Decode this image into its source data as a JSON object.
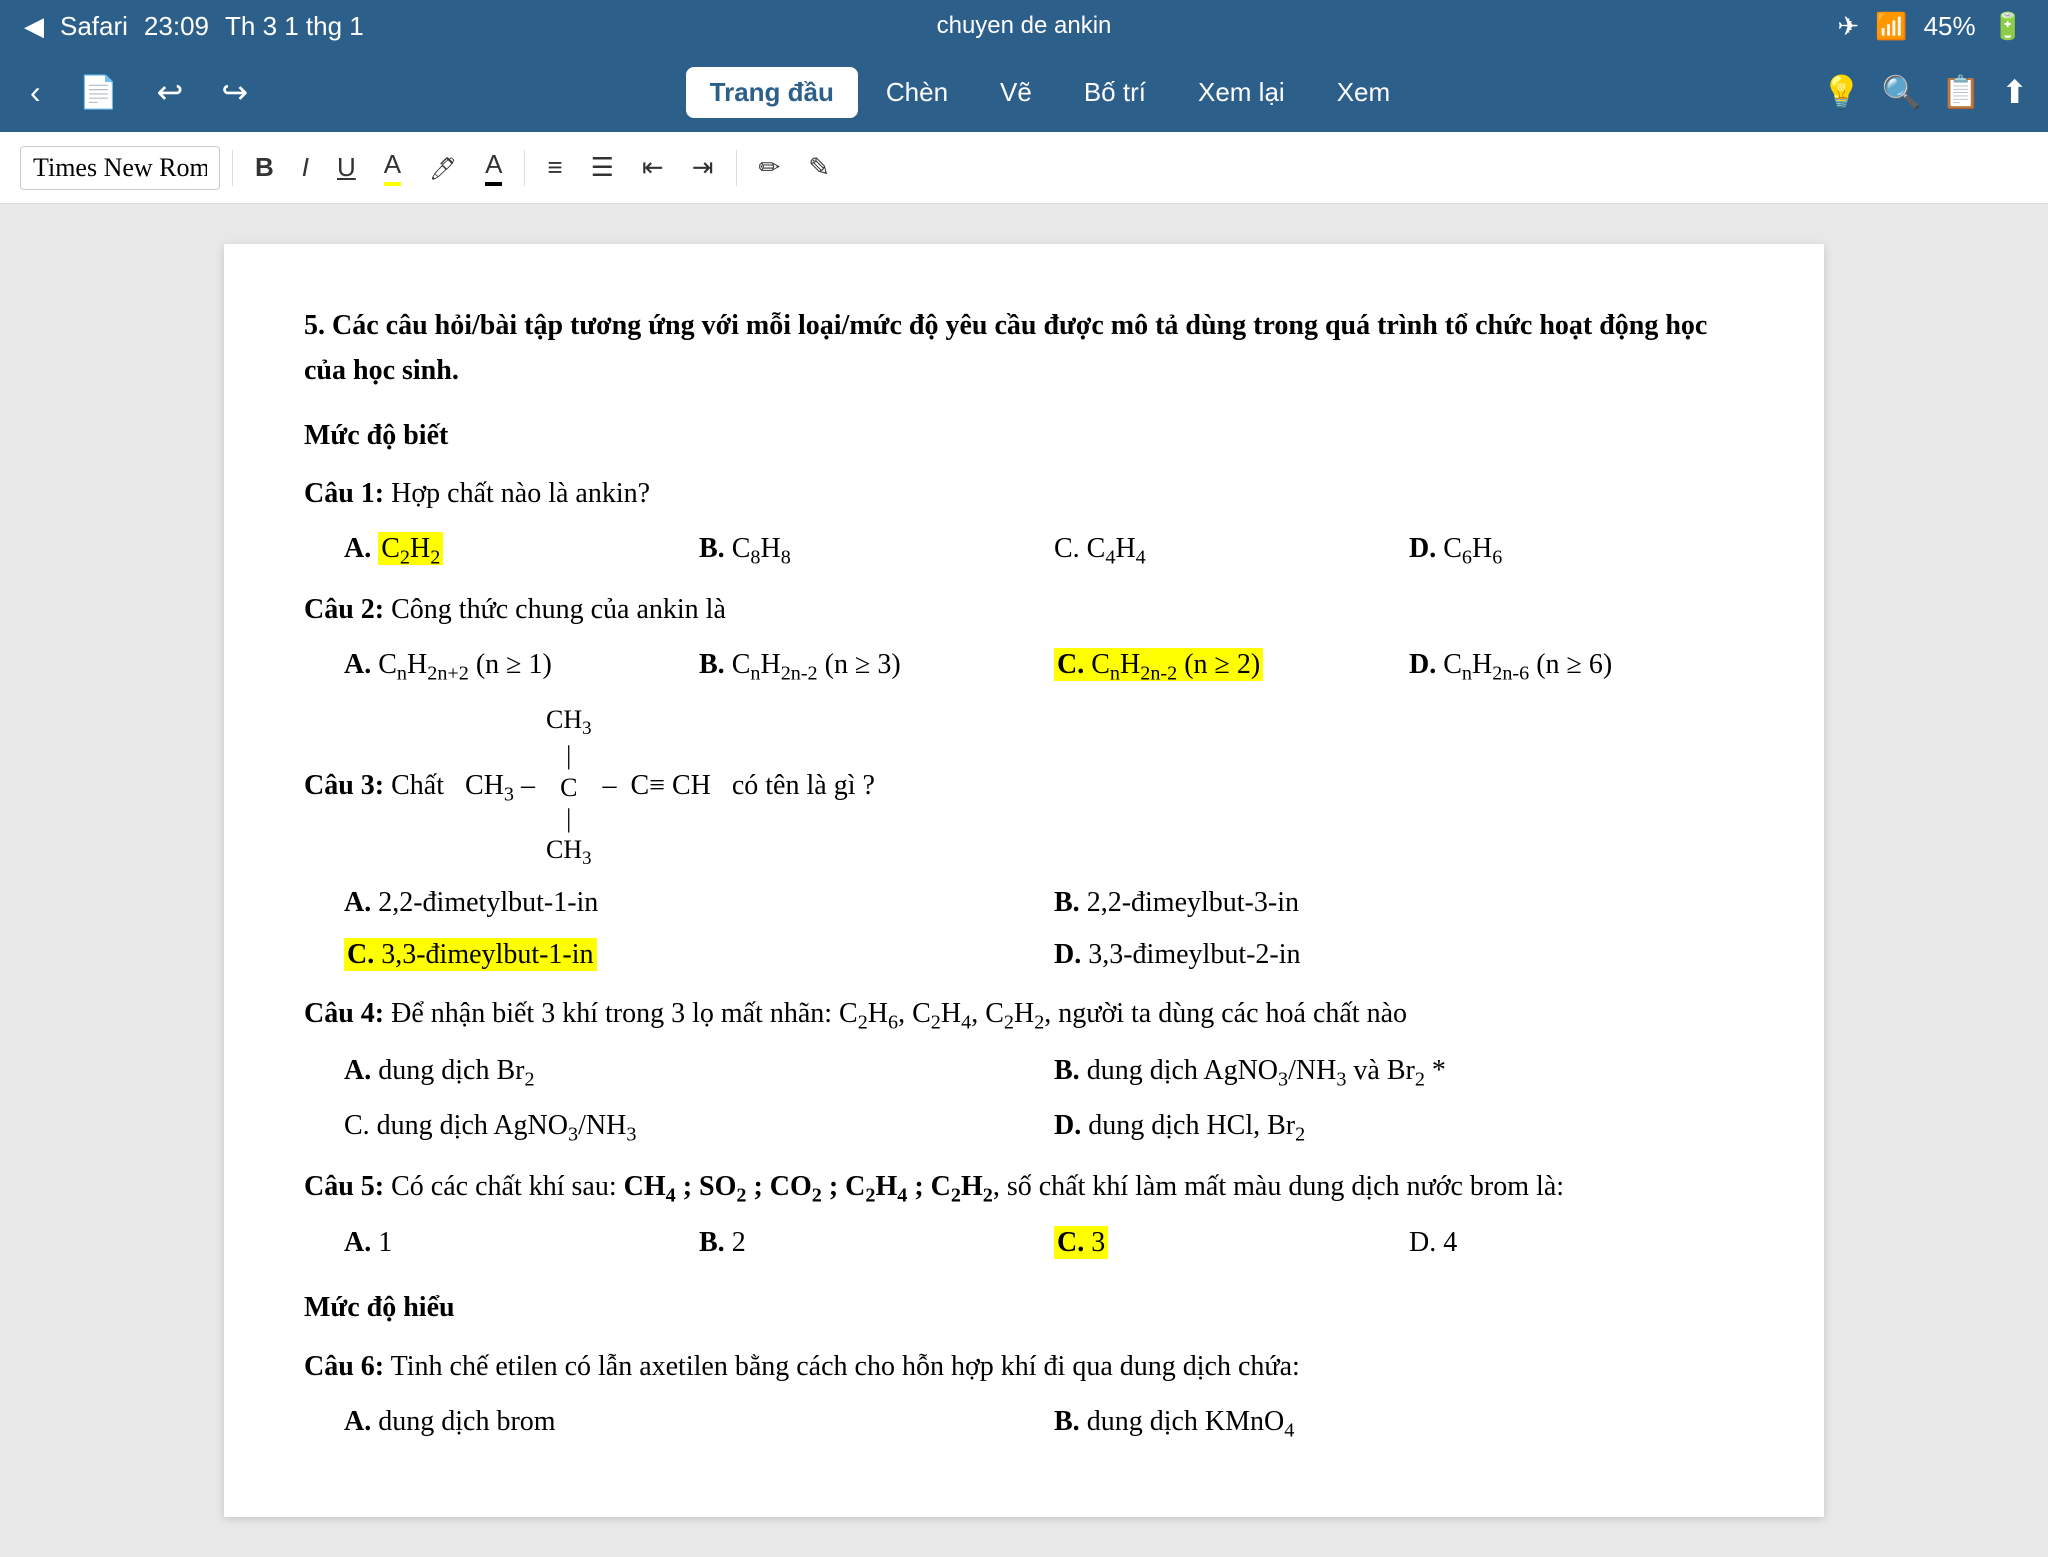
{
  "statusBar": {
    "app": "Safari",
    "time": "23:09",
    "date": "Th 3 1 thg 1",
    "docTitle": "chuyen de ankin",
    "battery": "45%"
  },
  "navTabs": [
    {
      "label": "Trang đầu",
      "active": true
    },
    {
      "label": "Chèn",
      "active": false
    },
    {
      "label": "Vẽ",
      "active": false
    },
    {
      "label": "Bố trí",
      "active": false
    },
    {
      "label": "Xem lại",
      "active": false
    },
    {
      "label": "Xem",
      "active": false
    }
  ],
  "toolbar": {
    "fontName": "Times New Roma",
    "boldLabel": "B",
    "italicLabel": "I",
    "underlineLabel": "U"
  },
  "content": {
    "sectionTitle": "5. Các câu hỏi/bài tập tương ứng với mỗi loại/mức độ yêu cầu được mô tả dùng trong quá trình tổ chức hoạt động học của học sinh.",
    "levels": [
      {
        "title": "Mức độ biết",
        "questions": [
          {
            "id": "1",
            "text": "Hợp chất nào là ankin?",
            "answers": [
              {
                "label": "A.",
                "text": "C₂H₂",
                "highlight": true
              },
              {
                "label": "B.",
                "text": "C₈H₈"
              },
              {
                "label": "C.",
                "text": "C₄H₄"
              },
              {
                "label": "D.",
                "text": "C₆H₆"
              }
            ],
            "layout": "4col"
          },
          {
            "id": "2",
            "text": "Công thức chung của ankin là",
            "answers": [
              {
                "label": "A.",
                "text": "CₙH₂ₙ₊₂ (n ≥ 1)"
              },
              {
                "label": "B.",
                "text": "CₙH₂ₙ-₂ (n ≥ 3)"
              },
              {
                "label": "C.",
                "text": "CₙH₂ₙ-₂ (n ≥ 2)",
                "highlight": true
              },
              {
                "label": "D.",
                "text": "CₙH₂ₙ-₆ (n ≥ 6)"
              }
            ],
            "layout": "4col"
          },
          {
            "id": "3",
            "text": "Chất  CH₃ – C – C≡ CH có tên là gì ?",
            "answers": [
              {
                "label": "A.",
                "text": "2,2-đimetylbut-1-in"
              },
              {
                "label": "B.",
                "text": "2,2-đimeylbut-3-in"
              },
              {
                "label": "C.",
                "text": "3,3-đimeylbut-1-in",
                "highlight": true
              },
              {
                "label": "D.",
                "text": "3,3-đimeylbut-2-in"
              }
            ],
            "layout": "2col"
          },
          {
            "id": "4",
            "text": "Để nhận biết 3 khí trong 3 lọ mất nhãn: C₂H₆, C₂H₄, C₂H₂, người ta dùng các hoá chất nào",
            "answers": [
              {
                "label": "A.",
                "text": "dung dịch Br₂"
              },
              {
                "label": "B.",
                "text": "dung dịch AgNO₃/NH₃ và Br₂ *"
              },
              {
                "label": "C.",
                "text": "dung dịch AgNO₃/NH₃"
              },
              {
                "label": "D.",
                "text": "dung dịch HCl, Br₂"
              }
            ],
            "layout": "2col"
          },
          {
            "id": "5",
            "text": "Có các chất khí sau: CH₄ ; SO₂ ; CO₂ ; C₂H₄ ; C₂H₂, số chất khí làm mất màu dung dịch nước brom là:",
            "answers": [
              {
                "label": "A.",
                "text": "1"
              },
              {
                "label": "B.",
                "text": "2"
              },
              {
                "label": "C.",
                "text": "3",
                "highlight": true
              },
              {
                "label": "D.",
                "text": "4"
              }
            ],
            "layout": "4col"
          }
        ]
      },
      {
        "title": "Mức độ hiểu",
        "questions": [
          {
            "id": "6",
            "text": "Tinh chế etilen có lẫn axetilen bằng cách cho hỗn hợp khí đi qua dung dịch chứa:",
            "answers": [
              {
                "label": "A.",
                "text": "dung dịch brom"
              },
              {
                "label": "B.",
                "text": "dung dịch KMnO₄"
              }
            ],
            "layout": "2col"
          }
        ]
      }
    ]
  }
}
